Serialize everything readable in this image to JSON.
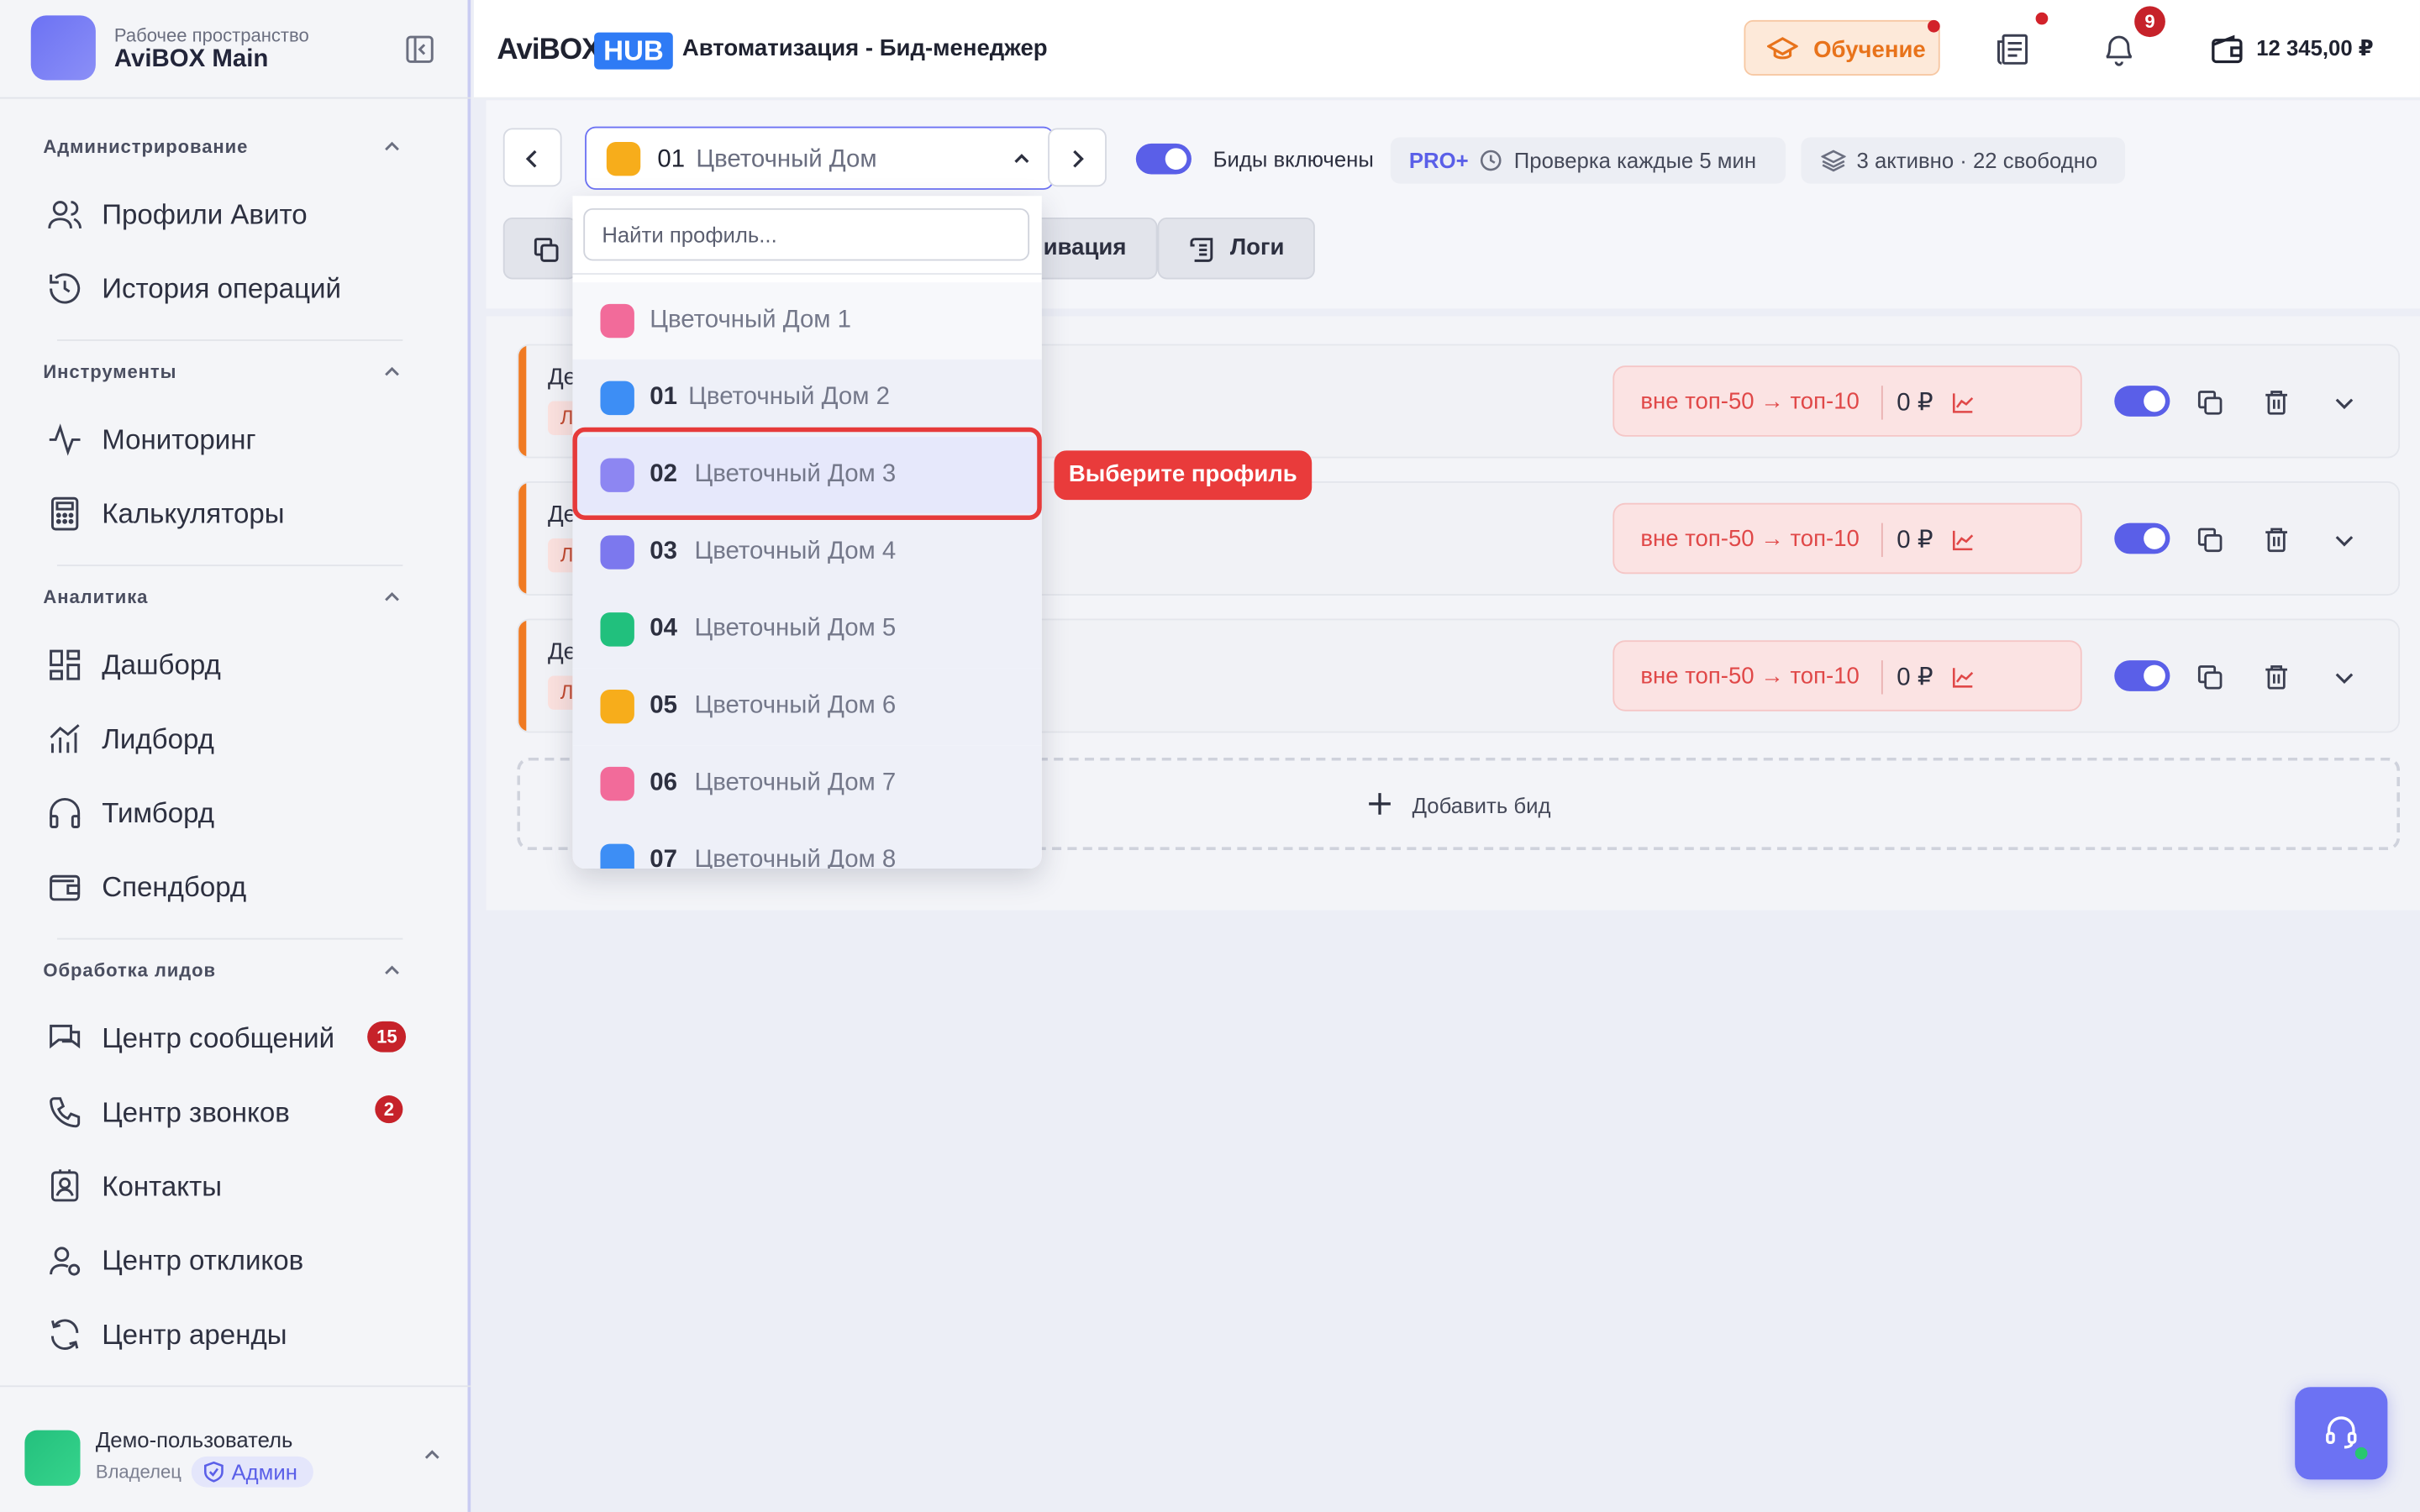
{
  "workspace": {
    "subtitle": "Рабочее пространство",
    "title": "AviBOX Main"
  },
  "sidebar": {
    "sections": [
      {
        "label": "Администрирование",
        "items": [
          {
            "label": "Профили Авито",
            "icon": "users-icon"
          },
          {
            "label": "История операций",
            "icon": "history-icon"
          }
        ]
      },
      {
        "label": "Инструменты",
        "items": [
          {
            "label": "Мониторинг",
            "icon": "activity-icon"
          },
          {
            "label": "Калькуляторы",
            "icon": "calculator-icon"
          }
        ]
      },
      {
        "label": "Аналитика",
        "items": [
          {
            "label": "Дашборд",
            "icon": "dashboard-icon"
          },
          {
            "label": "Лидборд",
            "icon": "chart-icon"
          },
          {
            "label": "Тимборд",
            "icon": "headphones-icon"
          },
          {
            "label": "Спендборд",
            "icon": "wallet-icon"
          }
        ]
      },
      {
        "label": "Обработка лидов",
        "items": [
          {
            "label": "Центр сообщений",
            "icon": "messages-icon",
            "badge": "15"
          },
          {
            "label": "Центр звонков",
            "icon": "phone-icon",
            "badge": "2"
          },
          {
            "label": "Контакты",
            "icon": "contacts-icon"
          },
          {
            "label": "Центр откликов",
            "icon": "user-response-icon"
          },
          {
            "label": "Центр аренды",
            "icon": "refresh-icon"
          }
        ]
      }
    ]
  },
  "user": {
    "name": "Демо-пользователь",
    "role": "Владелец",
    "badge": "Админ"
  },
  "header": {
    "brand_avi": "AviBOX",
    "brand_hub": "HUB",
    "title": "Автоматизация - Бид-менеджер",
    "learn_label": "Обучение",
    "notifications_count": "9",
    "balance": "12 345,00 ₽"
  },
  "toolbar": {
    "profile_number": "01",
    "profile_name": "Цветочный Дом",
    "bids_enabled_label": "Биды включены",
    "plan": "PRO+",
    "check_interval": "Проверка каждые 5 мин",
    "active_slots": "3 активно · 22 свободно",
    "tab_activation_label": "ивация",
    "tab_logs_label": "Логи"
  },
  "bids": [
    {
      "name_partial": "Дем",
      "tag_partial": "Ли",
      "range": "вне топ-50 → топ-10",
      "price": "0 ₽"
    },
    {
      "name_partial": "Дем",
      "tag_partial": "Ли",
      "range": "вне топ-50 → топ-10",
      "price": "0 ₽"
    },
    {
      "name_partial": "Дем",
      "tag_partial": "Ли",
      "range": "вне топ-50 → топ-10",
      "price": "0 ₽"
    }
  ],
  "add_bid_label": "Добавить бид",
  "dropdown": {
    "search_placeholder": "Найти профиль...",
    "items": [
      {
        "number": "",
        "name": "Цветочный Дом 1",
        "color": "#f26b9a"
      },
      {
        "number": "01",
        "name": "Цветочный Дом 2",
        "color": "#3d8ef5"
      },
      {
        "number": "02",
        "name": "Цветочный Дом 3",
        "color": "#8d86f2"
      },
      {
        "number": "03",
        "name": "Цветочный Дом 4",
        "color": "#7c78ee"
      },
      {
        "number": "04",
        "name": "Цветочный Дом 5",
        "color": "#21c07d"
      },
      {
        "number": "05",
        "name": "Цветочный Дом 6",
        "color": "#f7ad1b"
      },
      {
        "number": "06",
        "name": "Цветочный Дом 7",
        "color": "#f26b9a"
      },
      {
        "number": "07",
        "name": "Цветочный Дом 8",
        "color": "#3d8ef5"
      }
    ]
  },
  "tooltip": "Выберите профиль",
  "colors": {
    "accent": "#6c72f3",
    "brand_blue": "#2f7bf5",
    "orange": "#f07a22",
    "danger": "#e93b3b"
  }
}
